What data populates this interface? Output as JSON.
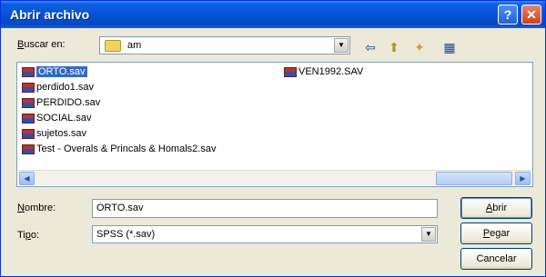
{
  "window": {
    "title": "Abrir archivo",
    "help_glyph": "?",
    "close_glyph": "✕"
  },
  "lookin": {
    "label_key": "B",
    "label_rest": "uscar en:",
    "value": "am",
    "drop_glyph": "▼"
  },
  "toolbar": {
    "back_glyph": "⇦",
    "up_glyph": "⬆",
    "newfolder_glyph": "✦",
    "view_glyph": "▦"
  },
  "files": [
    {
      "name": "ORTO.sav",
      "selected": true
    },
    {
      "name": "perdido1.sav",
      "selected": false
    },
    {
      "name": "PERDIDO.sav",
      "selected": false
    },
    {
      "name": "SOCIAL.sav",
      "selected": false
    },
    {
      "name": "sujetos.sav",
      "selected": false
    },
    {
      "name": "Test - Overals & Princals & Homals2.sav",
      "selected": false
    },
    {
      "name": "VEN1992.SAV",
      "selected": false
    }
  ],
  "scroll": {
    "left_glyph": "◀",
    "right_glyph": "▶"
  },
  "filename": {
    "label_key": "N",
    "label_rest": "ombre:",
    "value": "ORTO.sav"
  },
  "filetype": {
    "label_pre": "Ti",
    "label_key": "p",
    "label_rest": "o:",
    "value": "SPSS (*.sav)",
    "drop_glyph": "▼"
  },
  "buttons": {
    "open": {
      "key": "A",
      "rest": "brir"
    },
    "paste": {
      "key": "P",
      "rest": "egar"
    },
    "cancel": "Cancelar"
  }
}
